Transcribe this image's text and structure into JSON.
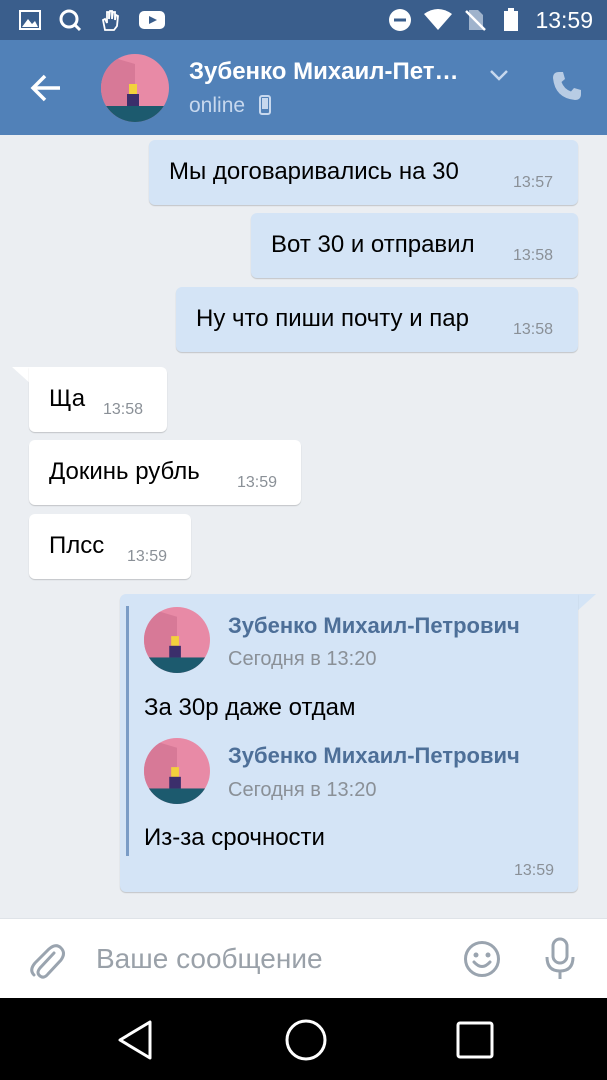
{
  "status_bar": {
    "time": "13:59",
    "icons_left": [
      "gallery-icon",
      "search-app-icon",
      "hand-gesture-icon",
      "youtube-icon"
    ],
    "icons_right": [
      "do-not-disturb-icon",
      "wifi-icon",
      "no-sim-icon",
      "battery-icon"
    ]
  },
  "header": {
    "contact_name": "Зубенко Михаил-Пет…",
    "status": "online",
    "colors": {
      "bar": "#5181b8",
      "status_bar": "#3a5e8c"
    }
  },
  "messages": [
    {
      "direction": "out",
      "text": "Мы договаривались на 30",
      "time": "13:57"
    },
    {
      "direction": "out",
      "text": "Вот 30 и отправил",
      "time": "13:58"
    },
    {
      "direction": "out",
      "text": "Ну что пиши почту и пар",
      "time": "13:58"
    },
    {
      "direction": "in",
      "text": "Ща",
      "time": "13:58"
    },
    {
      "direction": "in",
      "text": "Докинь рубль",
      "time": "13:59"
    },
    {
      "direction": "in",
      "text": "Плсс",
      "time": "13:59"
    }
  ],
  "forwarded_message": {
    "time": "13:59",
    "items": [
      {
        "author": "Зубенко Михаил-Петрович",
        "date": "Сегодня в 13:20",
        "text": "За 30р даже отдам"
      },
      {
        "author": "Зубенко Михаил-Петрович",
        "date": "Сегодня в 13:20",
        "text": "Из-за срочности"
      }
    ]
  },
  "composer": {
    "placeholder": "Ваше сообщение"
  },
  "nav": [
    "back-nav",
    "home-nav",
    "recents-nav"
  ]
}
